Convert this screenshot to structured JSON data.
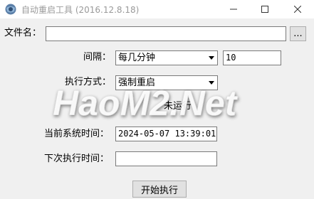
{
  "window": {
    "title": "自动重启工具 (2016.12.8.18)"
  },
  "form": {
    "file_label": "文件名：",
    "file_value": "",
    "browse_label": "...",
    "interval_label": "间隔：",
    "interval_selected": "每几分钟",
    "interval_value": "10",
    "method_label": "执行方式：",
    "method_selected": "强制重启",
    "status_text": "未运行",
    "current_time_label": "当前系统时间：",
    "current_time_value": "2024-05-07 13:39:01",
    "next_time_label": "下次执行时间：",
    "next_time_value": "",
    "start_button": "开始执行"
  },
  "watermark": {
    "text": "HaoM2.Net"
  },
  "colors": {
    "background": "#f0f0f0",
    "title_text": "#9a9a9a",
    "field_border": "#7a7a7a",
    "button_face": "#e1e1e1"
  }
}
